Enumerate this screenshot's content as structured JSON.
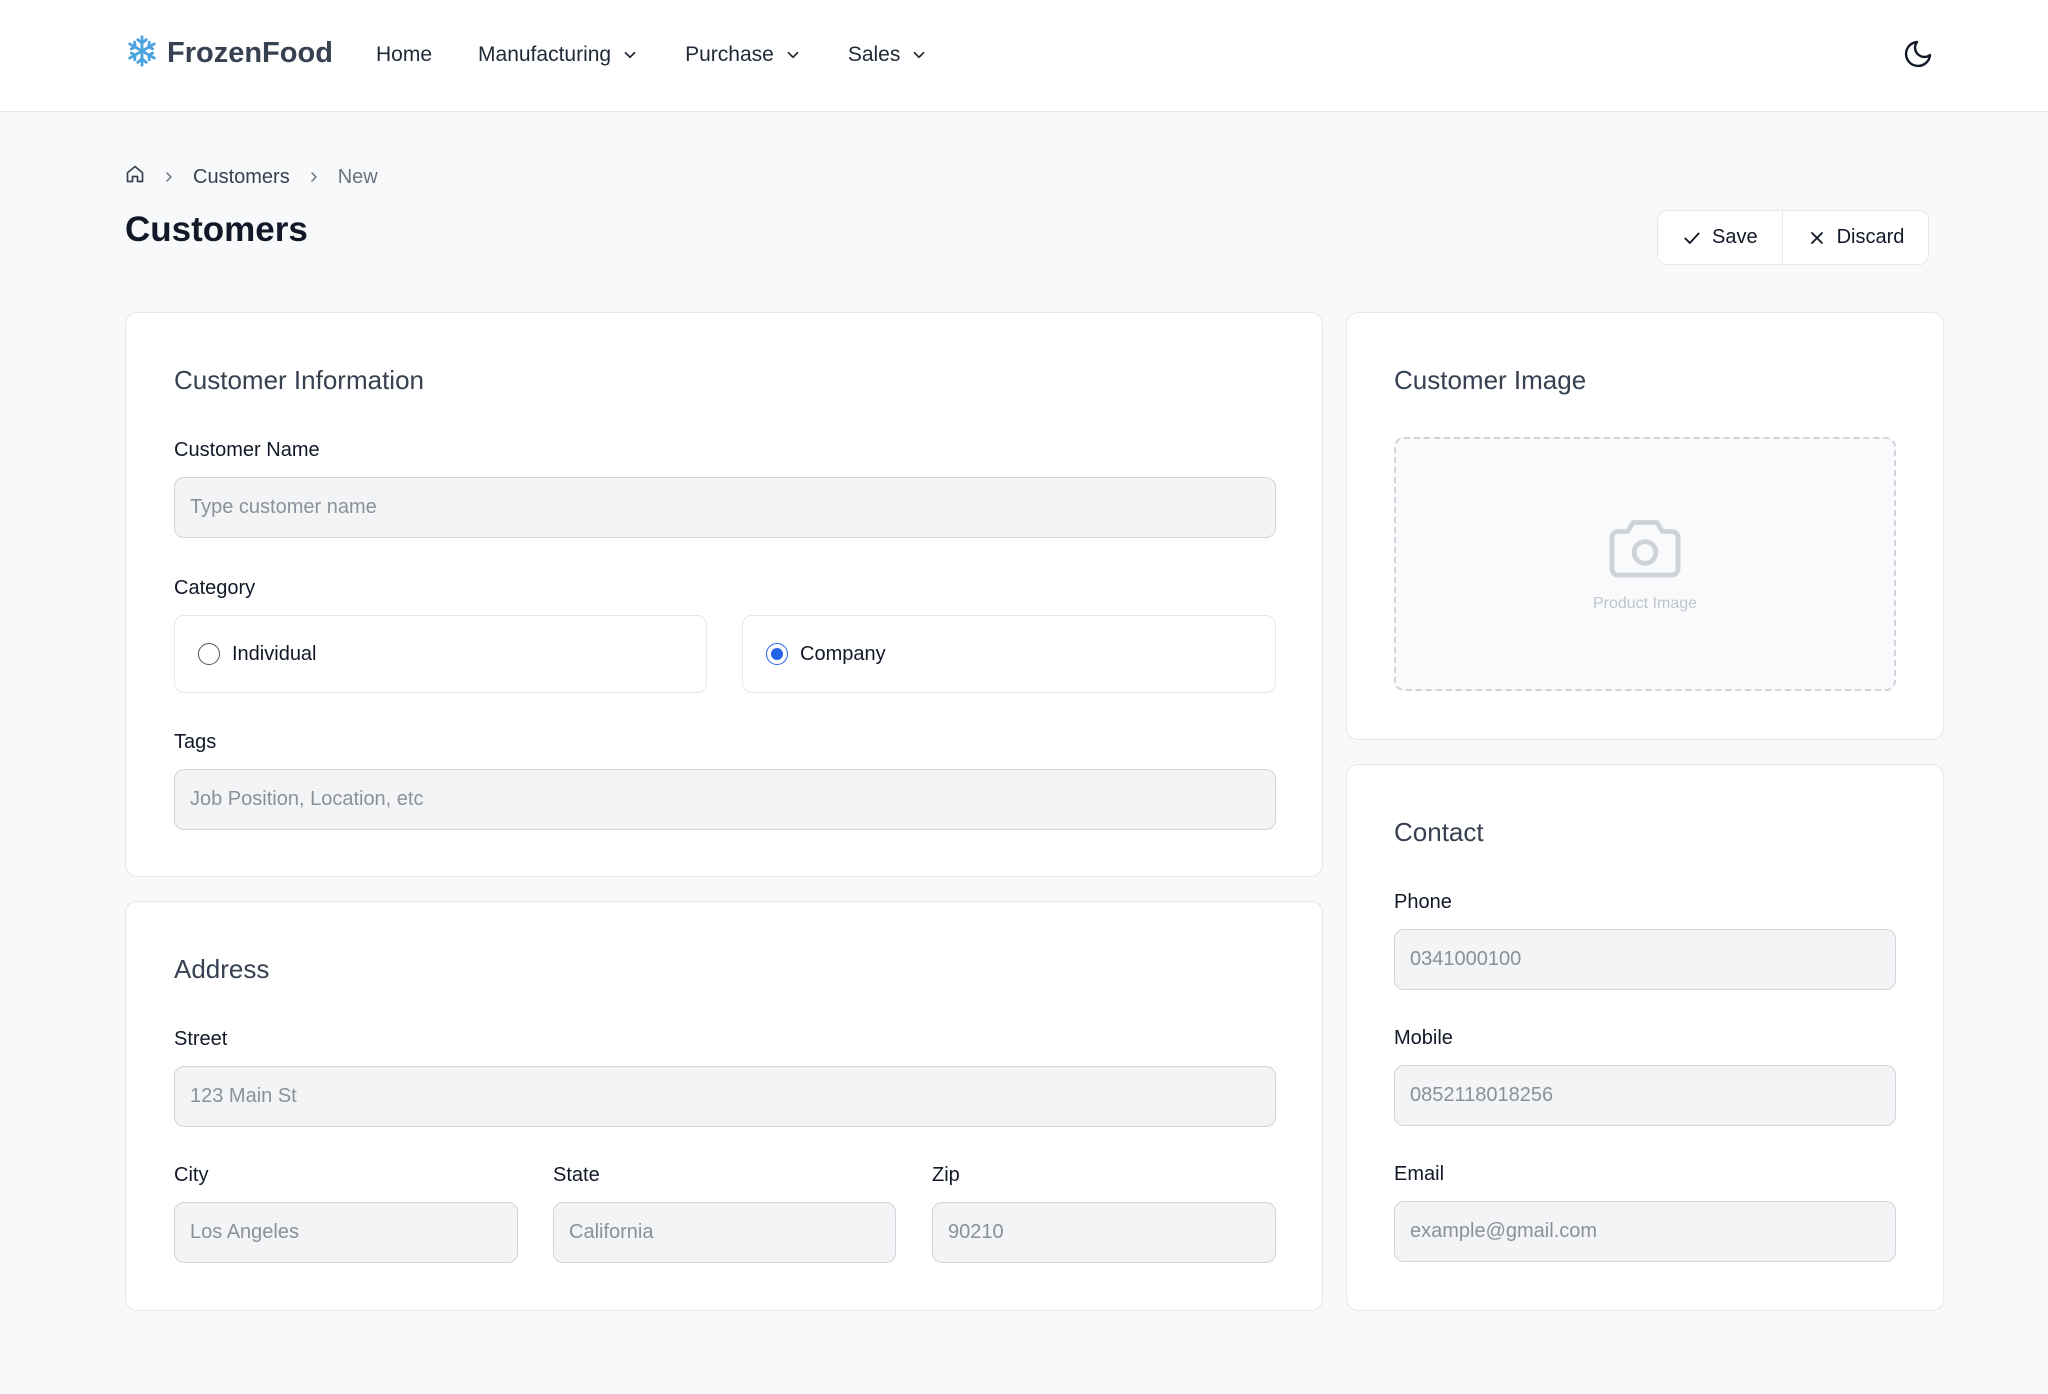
{
  "header": {
    "brand": "FrozenFood",
    "nav": [
      {
        "label": "Home",
        "dropdown": false
      },
      {
        "label": "Manufacturing",
        "dropdown": true
      },
      {
        "label": "Purchase",
        "dropdown": true
      },
      {
        "label": "Sales",
        "dropdown": true
      }
    ],
    "theme_icon": "moon-icon"
  },
  "breadcrumb": {
    "home_icon": "home-icon",
    "items": [
      "Customers",
      "New"
    ]
  },
  "page": {
    "title": "Customers",
    "save_label": "Save",
    "discard_label": "Discard"
  },
  "customer_info": {
    "title": "Customer Information",
    "name_label": "Customer Name",
    "name_placeholder": "Type customer name",
    "category_label": "Category",
    "category_options": [
      {
        "label": "Individual",
        "selected": false
      },
      {
        "label": "Company",
        "selected": true
      }
    ],
    "tags_label": "Tags",
    "tags_placeholder": "Job Position, Location, etc"
  },
  "address": {
    "title": "Address",
    "street_label": "Street",
    "street_placeholder": "123 Main St",
    "city_label": "City",
    "city_placeholder": "Los Angeles",
    "state_label": "State",
    "state_placeholder": "California",
    "zip_label": "Zip",
    "zip_placeholder": "90210"
  },
  "image": {
    "title": "Customer Image",
    "placeholder_label": "Product Image",
    "icon": "camera-icon"
  },
  "contact": {
    "title": "Contact",
    "phone_label": "Phone",
    "phone_placeholder": "0341000100",
    "mobile_label": "Mobile",
    "mobile_placeholder": "0852118018256",
    "email_label": "Email",
    "email_placeholder": "example@gmail.com"
  },
  "colors": {
    "accent": "#2563eb",
    "logo": "#4aa3df",
    "background": "#f8f9fb",
    "border": "#e5e7eb"
  }
}
